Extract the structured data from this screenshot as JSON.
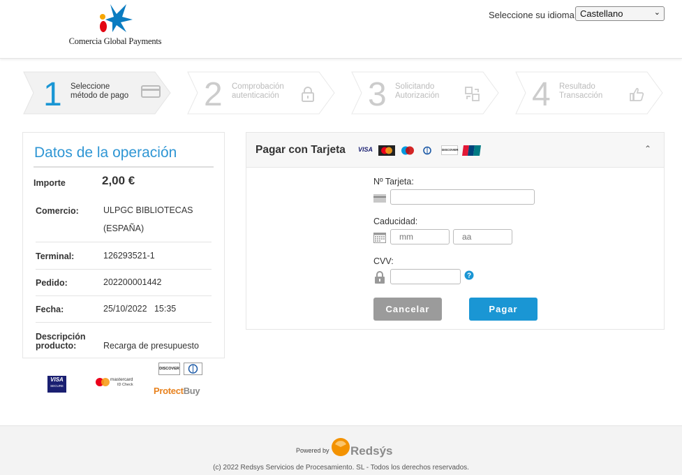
{
  "header": {
    "logo_text": "Comercia Global Payments",
    "language_label": "Seleccione su idioma",
    "language_selected": "Castellano"
  },
  "steps": [
    {
      "number": "1",
      "label": "Seleccione\nmétodo de pago",
      "state": "active",
      "icon": "card-icon"
    },
    {
      "number": "2",
      "label": "Comprobación\nautenticación",
      "state": "inactive",
      "icon": "lock-icon"
    },
    {
      "number": "3",
      "label": "Solicitando\nAutorización",
      "state": "inactive",
      "icon": "exchange-icon"
    },
    {
      "number": "4",
      "label": "Resultado\nTransacción",
      "state": "inactive",
      "icon": "thumbs-up-icon"
    }
  ],
  "operation": {
    "title": "Datos de la operación",
    "amount_label": "Importe",
    "amount_value": "2,00 €",
    "rows": [
      {
        "label": "Comercio:",
        "value": "ULPGC BIBLIOTECAS\n(ESPAÑA)"
      },
      {
        "label": "Terminal:",
        "value": "126293521-1"
      },
      {
        "label": "Pedido:",
        "value": "202200001442"
      },
      {
        "label": "Fecha:",
        "value": "25/10/2022   15:35"
      },
      {
        "label": "Descripción\nproducto:",
        "value": "Recarga de presupuesto"
      }
    ]
  },
  "secure_logos": {
    "visa_top": "VISA",
    "visa_bottom": "SECURE",
    "mastercard": "mastercard",
    "mastercard_sub": "ID Check",
    "discover": "DISCOVER",
    "protectbuy_a": "Protect",
    "protectbuy_b": "Buy"
  },
  "payment": {
    "title": "Pagar con Tarjeta",
    "card_number_label": "Nº Tarjeta:",
    "expiry_label": "Caducidad:",
    "month_placeholder": "mm",
    "year_placeholder": "aa",
    "cvv_label": "CVV:",
    "cancel_label": "Cancelar",
    "pay_label": "Pagar",
    "card_brands": [
      "VISA",
      "Mastercard",
      "Maestro",
      "Diners",
      "DISCOVER",
      "UnionPay"
    ]
  },
  "footer": {
    "powered_by": "Powered by",
    "brand": "Redsýs",
    "copyright": "(c) 2022 Redsys Servicios de Procesamiento. SL - Todos los derechos reservados."
  },
  "colors": {
    "accent": "#1a96d4",
    "cancel": "#9b9b9b"
  }
}
